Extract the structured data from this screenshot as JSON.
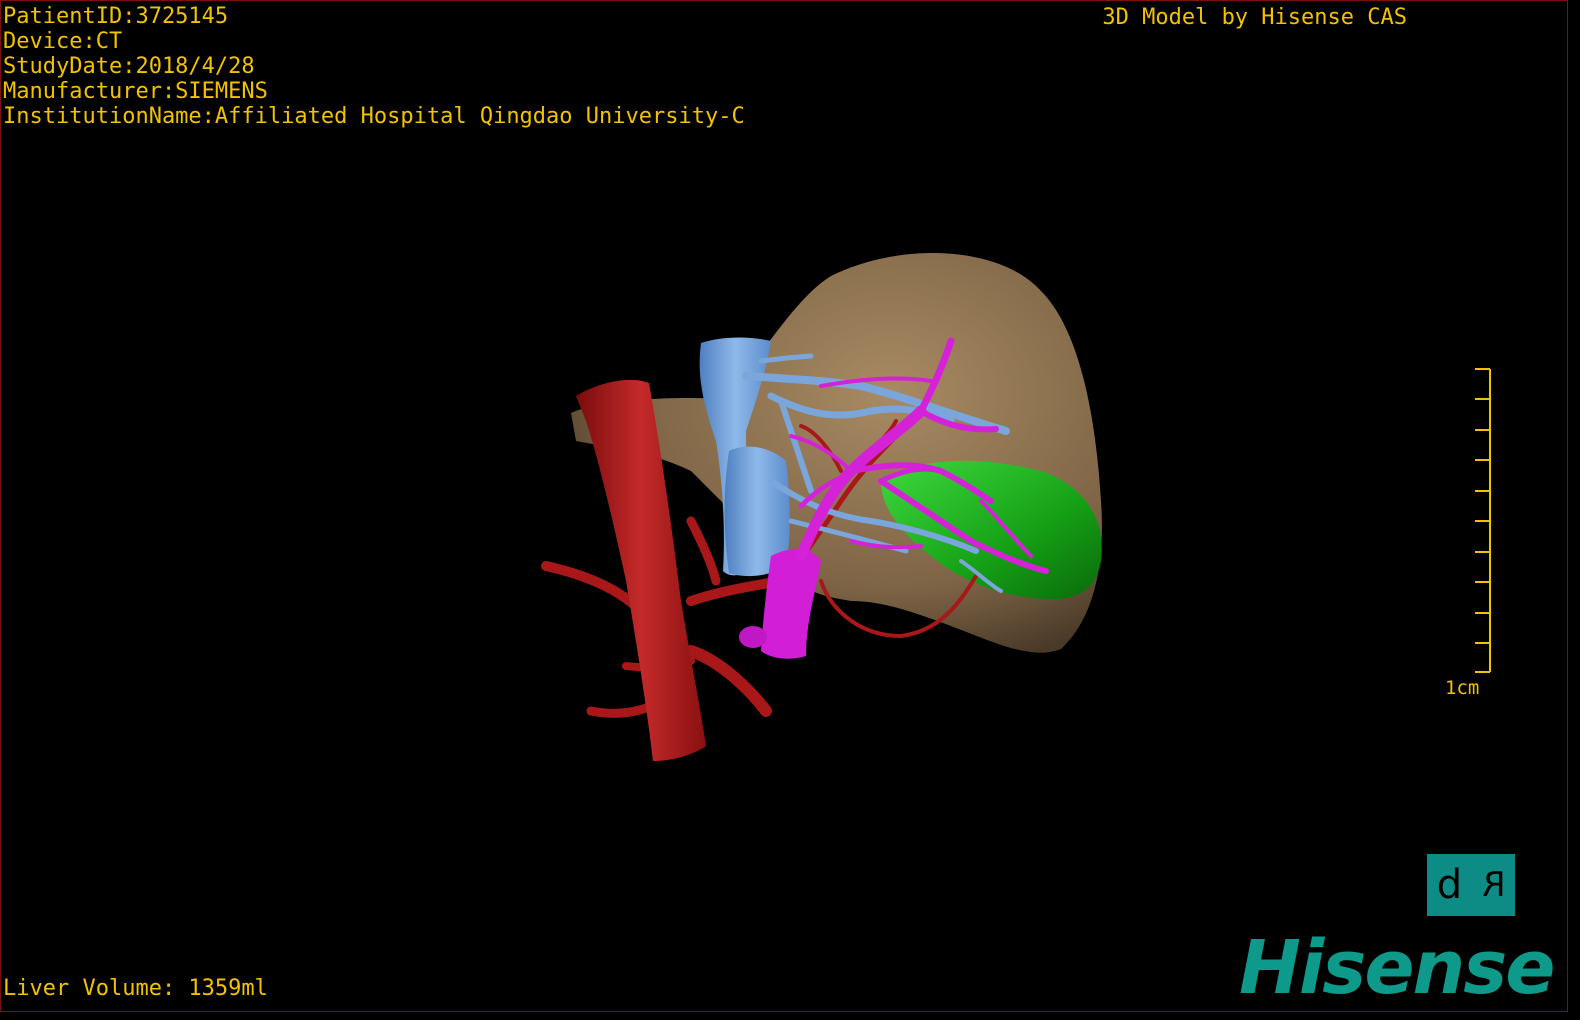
{
  "overlay": {
    "patient_id": "PatientID:3725145",
    "device": "Device:CT",
    "study_date": "StudyDate:2018/4/28",
    "manufacturer": "Manufacturer:SIEMENS",
    "institution": "InstitutionName:Affiliated Hospital Qingdao University-C",
    "watermark": "3D Model by Hisense CAS",
    "liver_volume": "Liver Volume: 1359ml"
  },
  "scale": {
    "label": "1cm"
  },
  "orientation": {
    "left_face": "d",
    "right_face": "R"
  },
  "brand": {
    "logo_text": "Hisense"
  },
  "colors": {
    "text": "#f2c200",
    "liver": "#8a6f4d",
    "artery": "#b51e1e",
    "portal_vein": "#d21ed6",
    "hepatic_vein": "#6f9fd8",
    "gallbladder": "#1fae1f",
    "brand": "#0d9a8a"
  },
  "structures": [
    "liver",
    "aorta",
    "hepatic-artery",
    "portal-vein",
    "hepatic-vein",
    "gallbladder"
  ]
}
